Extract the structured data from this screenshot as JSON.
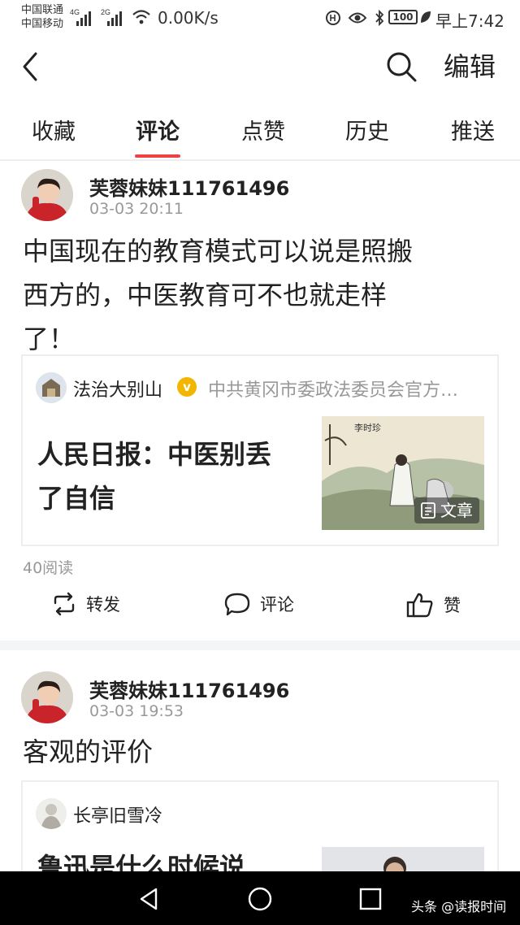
{
  "status_bar": {
    "carrier_1": "中国联通",
    "carrier_2": "中国移动",
    "net_1": "4G",
    "net_2": "2G",
    "speed": "0.00K/s",
    "battery": "100",
    "time": "早上7:42"
  },
  "top_bar": {
    "edit_label": "编辑"
  },
  "tabs": [
    {
      "label": "收藏"
    },
    {
      "label": "评论"
    },
    {
      "label": "点赞"
    },
    {
      "label": "历史"
    },
    {
      "label": "推送"
    }
  ],
  "active_tab": "评论",
  "colors": {
    "accent": "#f04142",
    "secondary_text": "#999999",
    "verified": "#f2b600"
  },
  "posts": [
    {
      "username": "芙蓉妹妹111761496",
      "timestamp": "03-03 20:11",
      "text_lines": [
        "中国现在的教育模式可以说是照搬",
        "西方的，中医教育可不也就走样",
        "了！"
      ],
      "card": {
        "author": "法治大别山",
        "author_desc": "中共黄冈市委政法委员会官方…",
        "title_lines": [
          "人民日报：中医别丢",
          "了自信"
        ],
        "thumb_badge": "文章",
        "thumb_caption": "李时珍"
      },
      "read_count": "40阅读",
      "actions": {
        "share": "转发",
        "comment": "评论",
        "like": "赞"
      }
    },
    {
      "username": "芙蓉妹妹111761496",
      "timestamp": "03-03 19:53",
      "text_lines": [
        "客观的评价"
      ],
      "card": {
        "author": "长亭旧雪冷",
        "title_lines": [
          "鲁迅是什么时候说"
        ]
      }
    }
  ],
  "watermark": "头条 @读报时间"
}
